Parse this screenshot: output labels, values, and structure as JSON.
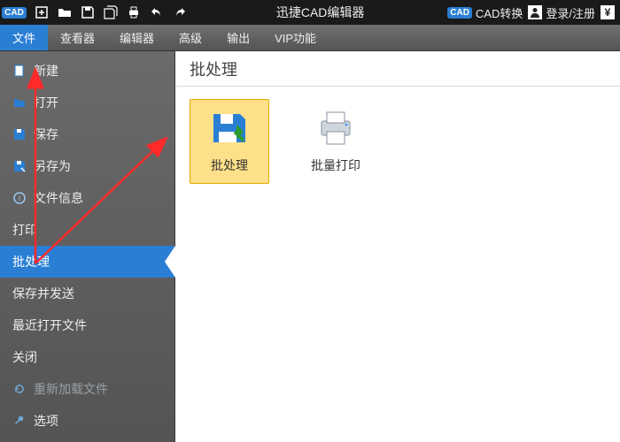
{
  "titlebar": {
    "app_title": "迅捷CAD编辑器",
    "cad_convert": "CAD转换",
    "login": "登录/注册"
  },
  "ribbon": {
    "tabs": [
      {
        "label": "文件",
        "active": true
      },
      {
        "label": "查看器",
        "active": false
      },
      {
        "label": "编辑器",
        "active": false
      },
      {
        "label": "高级",
        "active": false
      },
      {
        "label": "输出",
        "active": false
      },
      {
        "label": "VIP功能",
        "active": false
      }
    ]
  },
  "sidebar": {
    "items": [
      {
        "label": "新建",
        "icon": "new-file-icon"
      },
      {
        "label": "打开",
        "icon": "open-folder-icon"
      },
      {
        "label": "保存",
        "icon": "save-icon"
      },
      {
        "label": "另存为",
        "icon": "save-as-icon"
      },
      {
        "label": "文件信息",
        "icon": "info-icon"
      },
      {
        "label": "打印",
        "icon": ""
      },
      {
        "label": "批处理",
        "icon": "",
        "active": true
      },
      {
        "label": "保存并发送",
        "icon": ""
      },
      {
        "label": "最近打开文件",
        "icon": ""
      },
      {
        "label": "关闭",
        "icon": ""
      },
      {
        "label": "重新加载文件",
        "icon": "reload-icon",
        "disabled": true
      },
      {
        "label": "选项",
        "icon": "wrench-icon"
      }
    ]
  },
  "content": {
    "header": "批处理",
    "tiles": [
      {
        "label": "批处理",
        "icon": "batch-save-icon",
        "selected": true
      },
      {
        "label": "批量打印",
        "icon": "batch-print-icon",
        "selected": false
      }
    ]
  },
  "colors": {
    "accent": "#2a7fd4",
    "highlight": "#ffe08a",
    "arrow": "#ff2a2a"
  }
}
